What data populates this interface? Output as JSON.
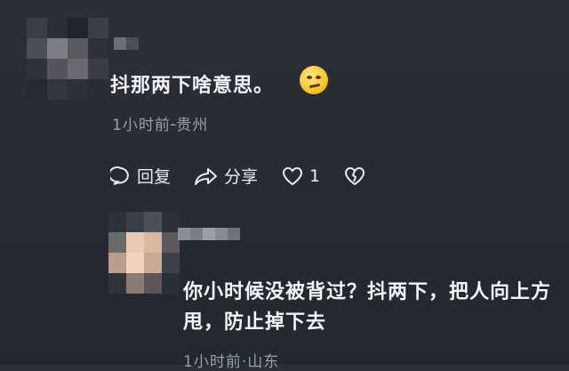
{
  "comment1": {
    "text": "抖那两下啥意思。",
    "emoji": "smirk-face-emoji",
    "meta_time": "1小时前",
    "meta_sep": "·",
    "meta_location": "贵州"
  },
  "actions": {
    "reply_label": "回复",
    "share_label": "分享",
    "like_count": "1"
  },
  "reply": {
    "text": "你小时候没被背过？抖两下，把人向上方甩，防止掉下去",
    "meta_time": "1小时前",
    "meta_sep": "·",
    "meta_location": "山东"
  },
  "colors": {
    "background": "#272b33",
    "text": "#f4f5f7",
    "meta": "#9aa0a8"
  }
}
